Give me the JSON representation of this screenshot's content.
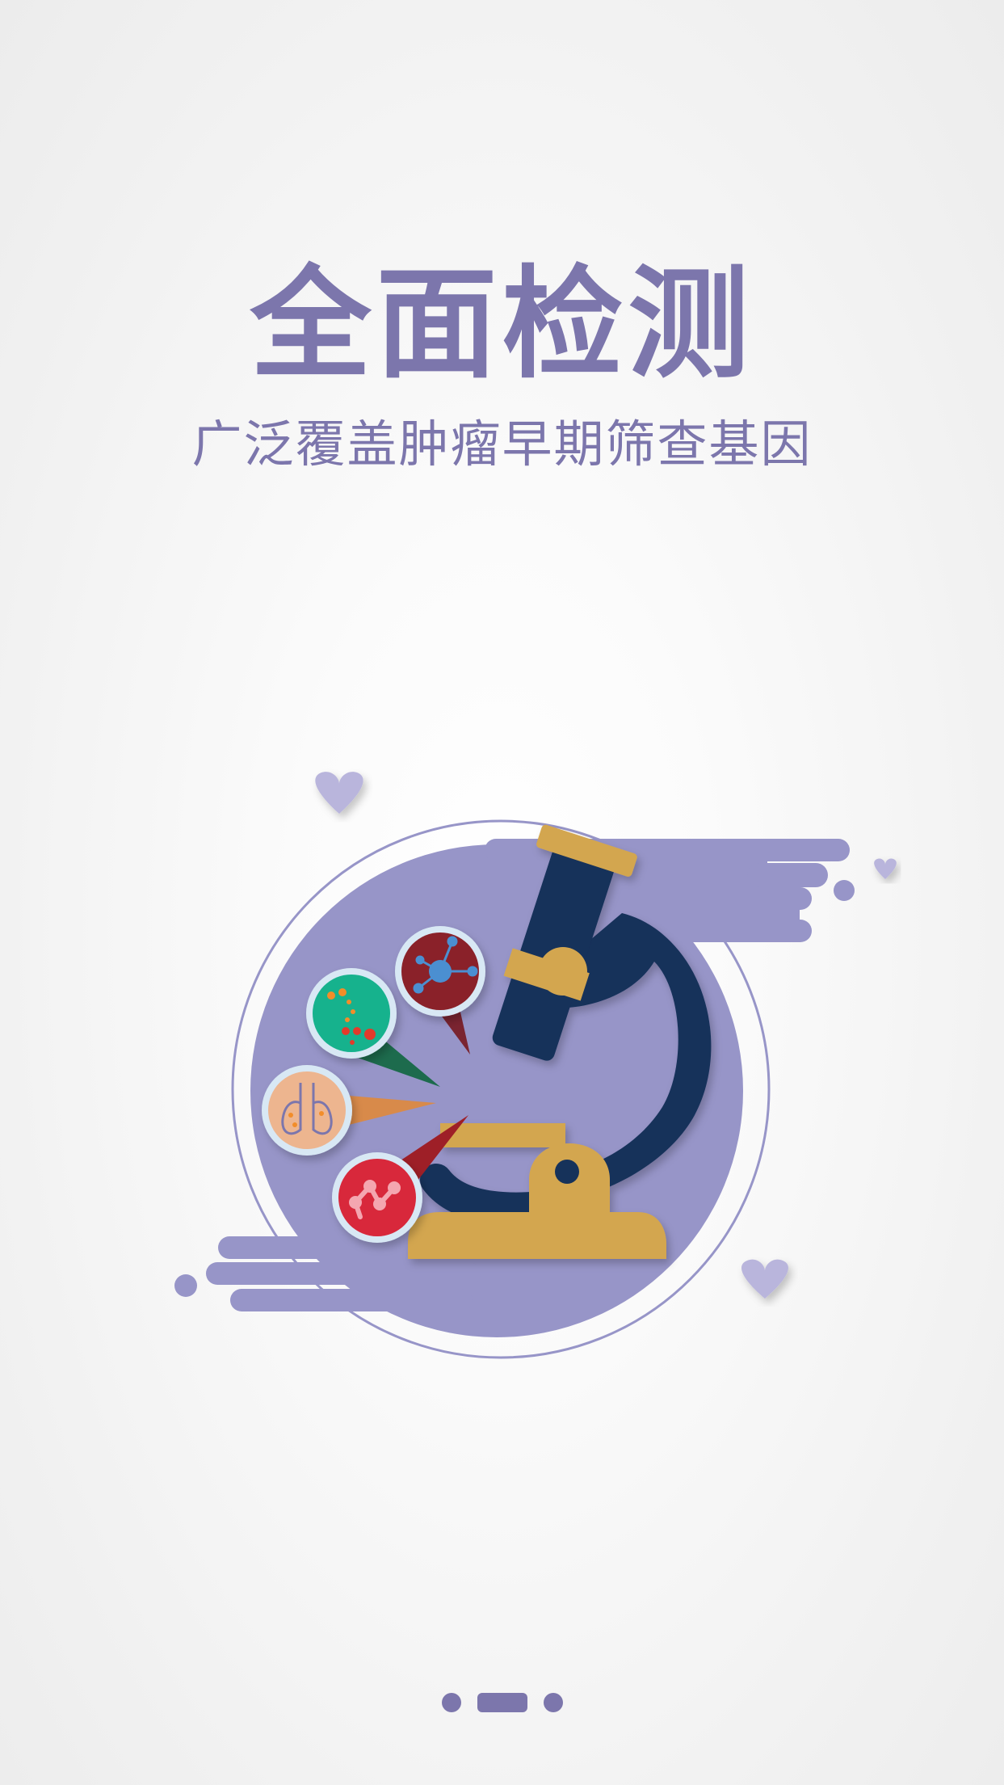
{
  "hero": {
    "title": "全面检测",
    "subtitle": "广泛覆盖肿瘤早期筛查基因"
  },
  "illustration": {
    "subject": "microscope-with-cell-magnifier-bubbles",
    "bubbles": [
      "cell-network",
      "cell-clusters",
      "lungs",
      "molecule-chain"
    ]
  },
  "pager": {
    "total_pages": 3,
    "active_page": 2
  },
  "colors": {
    "primary": "#7c76ac",
    "lavender": "#9795c8",
    "navy": "#17305a",
    "gold": "#d3a650",
    "heart": "#b9b5dc"
  }
}
